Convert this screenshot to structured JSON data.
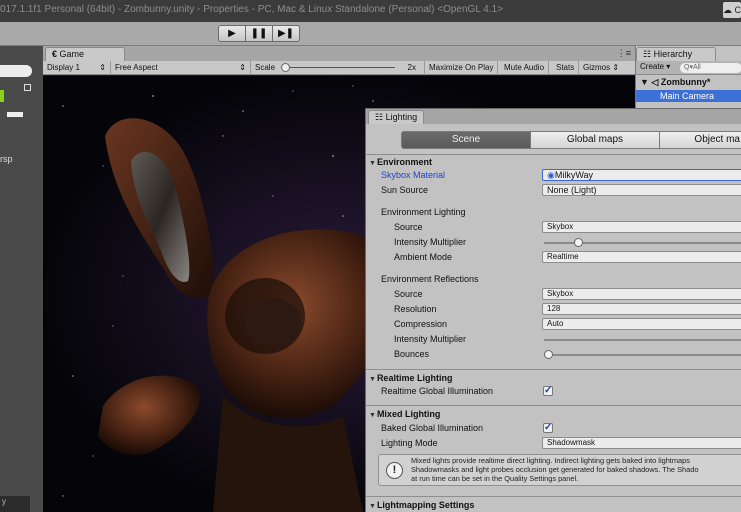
{
  "window": {
    "title": "017.1.1f1 Personal (64bit) - Zombunny.unity - Properties - PC, Mac & Linux Standalone (Personal) <OpenGL 4.1>",
    "top_right_glyph": "☁ C"
  },
  "toolbar": {
    "play_icon": "play-icon",
    "pause_icon": "pause-icon",
    "step_icon": "step-icon",
    "play_glyph": "▶",
    "pause_glyph": "❚❚",
    "step_glyph": "▶❚"
  },
  "scene_strip": {
    "persp_label": "rsp",
    "bottom_label": "y"
  },
  "game": {
    "tab_label": "Game",
    "display": "Display 1",
    "aspect": "Free Aspect",
    "scale_label": "Scale",
    "scale_value": "2x",
    "maximize_on_play": "Maximize On Play",
    "mute_audio": "Mute Audio",
    "stats": "Stats",
    "gizmos": "Gizmos"
  },
  "hierarchy": {
    "tab_label": "Hierarchy",
    "create_label": "Create ▾",
    "search_placeholder": "Q▾All",
    "scene_name": "Zombunny*",
    "items": [
      {
        "label": "Main Camera",
        "selected": true
      }
    ]
  },
  "lighting": {
    "tab_label": "Lighting",
    "tabs": [
      {
        "label": "Scene",
        "active": true
      },
      {
        "label": "Global maps",
        "active": false
      },
      {
        "label": "Object ma",
        "active": false
      }
    ],
    "environment": {
      "header": "Environment",
      "skybox_material_label": "Skybox Material",
      "skybox_material_value": "MilkyWay",
      "sun_source_label": "Sun Source",
      "sun_source_value": "None (Light)",
      "env_lighting_label": "Environment Lighting",
      "source_label": "Source",
      "source_value": "Skybox",
      "intensity_label": "Intensity Multiplier",
      "intensity_value": 0.16,
      "ambient_mode_label": "Ambient Mode",
      "ambient_mode_value": "Realtime",
      "env_reflections_label": "Environment Reflections",
      "refl_source_label": "Source",
      "refl_source_value": "Skybox",
      "resolution_label": "Resolution",
      "resolution_value": "128",
      "compression_label": "Compression",
      "compression_value": "Auto",
      "refl_intensity_label": "Intensity Multiplier",
      "bounces_label": "Bounces",
      "bounces_value": 0
    },
    "realtime": {
      "header": "Realtime Lighting",
      "gi_label": "Realtime Global Illumination",
      "gi_checked": "✓"
    },
    "mixed": {
      "header": "Mixed Lighting",
      "baked_gi_label": "Baked Global Illumination",
      "baked_gi_checked": "✓",
      "mode_label": "Lighting Mode",
      "mode_value": "Shadowmask",
      "info_icon": "!",
      "info_lines": [
        "Mixed lights provide realtime direct lighting. Indirect lighting gets baked into lightmaps",
        "Shadowmasks and light probes occlusion get generated for baked shadows. The Shado",
        "at run time can be set in the Quality Settings panel."
      ]
    },
    "lightmapping": {
      "header": "Lightmapping Settings"
    }
  },
  "colors": {
    "selection_blue": "#3d70d6",
    "label_blue": "#1d46c8",
    "panel_gray": "#c2c2c2"
  }
}
